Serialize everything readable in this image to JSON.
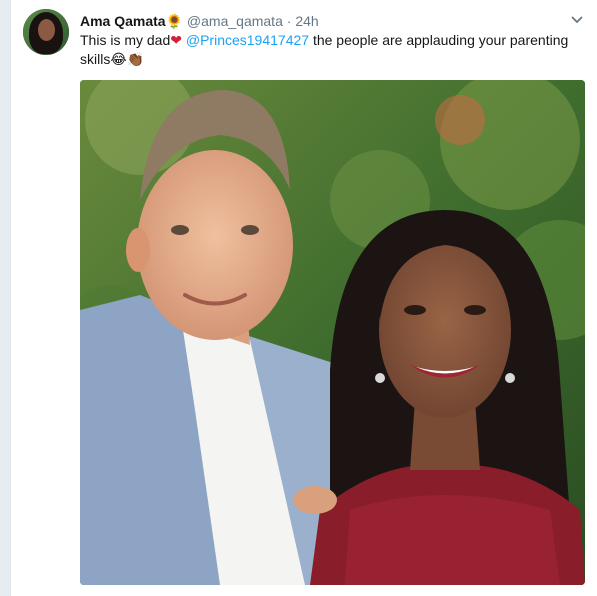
{
  "tweet": {
    "author_name": "Ama Qamata",
    "author_emoji": "🌻",
    "handle": "@ama_qamata",
    "separator": "·",
    "time": "24h",
    "text_part1": "This is my dad",
    "heart_emoji": "❤",
    "mention": "@Princes19417427",
    "text_part2": "the people are applauding your parenting skills",
    "trailing_emojis": "😂👏🏾"
  },
  "icons": {
    "menu": "chevron-down-icon"
  },
  "colors": {
    "link": "#1da1f2",
    "text": "#14171a",
    "muted": "#657786",
    "heart": "#d61e35"
  }
}
